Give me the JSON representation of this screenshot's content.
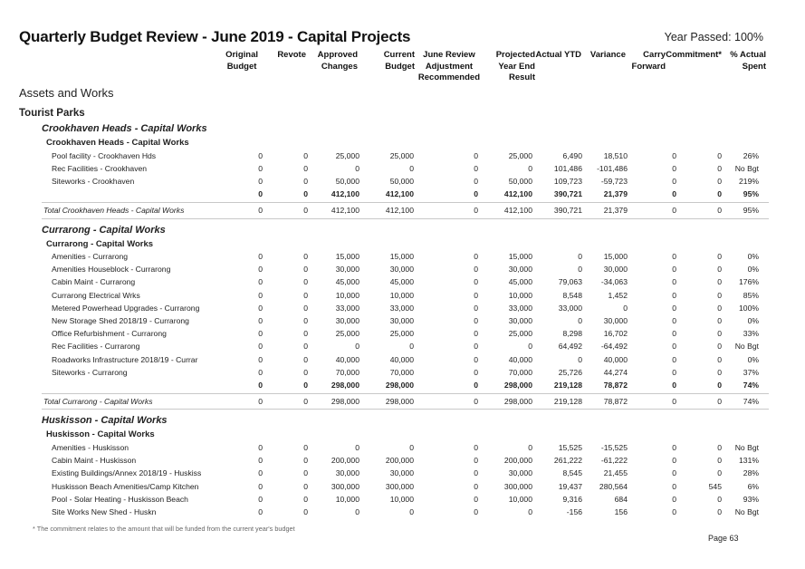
{
  "title": "Quarterly Budget Review - June 2019 - Capital Projects",
  "year_passed": "Year Passed: 100%",
  "columns": [
    {
      "key": "original_budget",
      "lines": [
        "Original",
        "Budget"
      ]
    },
    {
      "key": "revote",
      "lines": [
        "Revote"
      ]
    },
    {
      "key": "approved_changes",
      "lines": [
        "Approved",
        "Changes"
      ]
    },
    {
      "key": "current_budget",
      "lines": [
        "Current",
        "Budget"
      ]
    },
    {
      "key": "june_review",
      "lines": [
        "June Review",
        "Adjustment",
        "Recommended"
      ]
    },
    {
      "key": "projected",
      "lines": [
        "Projected",
        "Year End",
        "Result"
      ]
    },
    {
      "key": "actual_ytd",
      "lines": [
        "Actual YTD"
      ]
    },
    {
      "key": "variance",
      "lines": [
        "Variance"
      ]
    },
    {
      "key": "carry_forward",
      "lines": [
        "Carry",
        "Forward"
      ]
    },
    {
      "key": "commitment",
      "lines": [
        "Commitment*"
      ]
    },
    {
      "key": "pct_spent",
      "lines": [
        "% Actual",
        "Spent"
      ]
    }
  ],
  "headings": {
    "division": "Assets and Works",
    "group": "Tourist Parks"
  },
  "sections": [
    {
      "title": "Crookhaven Heads - Capital Works",
      "subtitle": "Crookhaven Heads - Capital Works",
      "rows": [
        {
          "name": "Pool facility - Crookhaven Hds",
          "values": [
            "0",
            "0",
            "25,000",
            "25,000",
            "0",
            "25,000",
            "6,490",
            "18,510",
            "0",
            "0",
            "26%"
          ]
        },
        {
          "name": "Rec Facilities - Crookhaven",
          "values": [
            "0",
            "0",
            "0",
            "0",
            "0",
            "0",
            "101,486",
            "-101,486",
            "0",
            "0",
            "No Bgt"
          ]
        },
        {
          "name": "Siteworks - Crookhaven",
          "values": [
            "0",
            "0",
            "50,000",
            "50,000",
            "0",
            "50,000",
            "109,723",
            "-59,723",
            "0",
            "0",
            "219%"
          ]
        }
      ],
      "subtotal": [
        "0",
        "0",
        "412,100",
        "412,100",
        "0",
        "412,100",
        "390,721",
        "21,379",
        "0",
        "0",
        "95%"
      ],
      "total_label": "Total Crookhaven Heads - Capital Works",
      "total": [
        "0",
        "0",
        "412,100",
        "412,100",
        "0",
        "412,100",
        "390,721",
        "21,379",
        "0",
        "0",
        "95%"
      ]
    },
    {
      "title": "Currarong - Capital Works",
      "subtitle": "Currarong - Capital Works",
      "rows": [
        {
          "name": "Amenities - Currarong",
          "values": [
            "0",
            "0",
            "15,000",
            "15,000",
            "0",
            "15,000",
            "0",
            "15,000",
            "0",
            "0",
            "0%"
          ]
        },
        {
          "name": "Amenities Houseblock - Currarong",
          "values": [
            "0",
            "0",
            "30,000",
            "30,000",
            "0",
            "30,000",
            "0",
            "30,000",
            "0",
            "0",
            "0%"
          ]
        },
        {
          "name": "Cabin Maint - Currarong",
          "values": [
            "0",
            "0",
            "45,000",
            "45,000",
            "0",
            "45,000",
            "79,063",
            "-34,063",
            "0",
            "0",
            "176%"
          ]
        },
        {
          "name": "Currarong Electrical Wrks",
          "values": [
            "0",
            "0",
            "10,000",
            "10,000",
            "0",
            "10,000",
            "8,548",
            "1,452",
            "0",
            "0",
            "85%"
          ]
        },
        {
          "name": "Metered Powerhead Upgrades - Currarong",
          "values": [
            "0",
            "0",
            "33,000",
            "33,000",
            "0",
            "33,000",
            "33,000",
            "0",
            "0",
            "0",
            "100%"
          ]
        },
        {
          "name": "New Storage Shed 2018/19 - Currarong",
          "values": [
            "0",
            "0",
            "30,000",
            "30,000",
            "0",
            "30,000",
            "0",
            "30,000",
            "0",
            "0",
            "0%"
          ]
        },
        {
          "name": "Office Refurbishment - Currarong",
          "values": [
            "0",
            "0",
            "25,000",
            "25,000",
            "0",
            "25,000",
            "8,298",
            "16,702",
            "0",
            "0",
            "33%"
          ]
        },
        {
          "name": "Rec Facilities - Currarong",
          "values": [
            "0",
            "0",
            "0",
            "0",
            "0",
            "0",
            "64,492",
            "-64,492",
            "0",
            "0",
            "No Bgt"
          ]
        },
        {
          "name": "Roadworks Infrastructure 2018/19 - Currar",
          "values": [
            "0",
            "0",
            "40,000",
            "40,000",
            "0",
            "40,000",
            "0",
            "40,000",
            "0",
            "0",
            "0%"
          ]
        },
        {
          "name": "Siteworks - Currarong",
          "values": [
            "0",
            "0",
            "70,000",
            "70,000",
            "0",
            "70,000",
            "25,726",
            "44,274",
            "0",
            "0",
            "37%"
          ]
        }
      ],
      "subtotal": [
        "0",
        "0",
        "298,000",
        "298,000",
        "0",
        "298,000",
        "219,128",
        "78,872",
        "0",
        "0",
        "74%"
      ],
      "total_label": "Total Currarong - Capital Works",
      "total": [
        "0",
        "0",
        "298,000",
        "298,000",
        "0",
        "298,000",
        "219,128",
        "78,872",
        "0",
        "0",
        "74%"
      ]
    },
    {
      "title": "Huskisson - Capital Works",
      "subtitle": "Huskisson - Capital Works",
      "rows": [
        {
          "name": "Amenities - Huskisson",
          "values": [
            "0",
            "0",
            "0",
            "0",
            "0",
            "0",
            "15,525",
            "-15,525",
            "0",
            "0",
            "No Bgt"
          ]
        },
        {
          "name": "Cabin Maint - Huskisson",
          "values": [
            "0",
            "0",
            "200,000",
            "200,000",
            "0",
            "200,000",
            "261,222",
            "-61,222",
            "0",
            "0",
            "131%"
          ]
        },
        {
          "name": "Existing Buildings/Annex 2018/19 - Huskiss",
          "values": [
            "0",
            "0",
            "30,000",
            "30,000",
            "0",
            "30,000",
            "8,545",
            "21,455",
            "0",
            "0",
            "28%"
          ]
        },
        {
          "name": "Huskisson Beach Amenities/Camp Kitchen",
          "values": [
            "0",
            "0",
            "300,000",
            "300,000",
            "0",
            "300,000",
            "19,437",
            "280,564",
            "0",
            "545",
            "6%"
          ]
        },
        {
          "name": "Pool - Solar Heating - Huskisson Beach",
          "values": [
            "0",
            "0",
            "10,000",
            "10,000",
            "0",
            "10,000",
            "9,316",
            "684",
            "0",
            "0",
            "93%"
          ]
        },
        {
          "name": "Site Works New Shed - Huskn",
          "values": [
            "0",
            "0",
            "0",
            "0",
            "0",
            "0",
            "-156",
            "156",
            "0",
            "0",
            "No Bgt"
          ]
        }
      ]
    }
  ],
  "footnote": "* The commitment relates to the amount that will be funded from the current year's budget",
  "page_number": "Page 63"
}
